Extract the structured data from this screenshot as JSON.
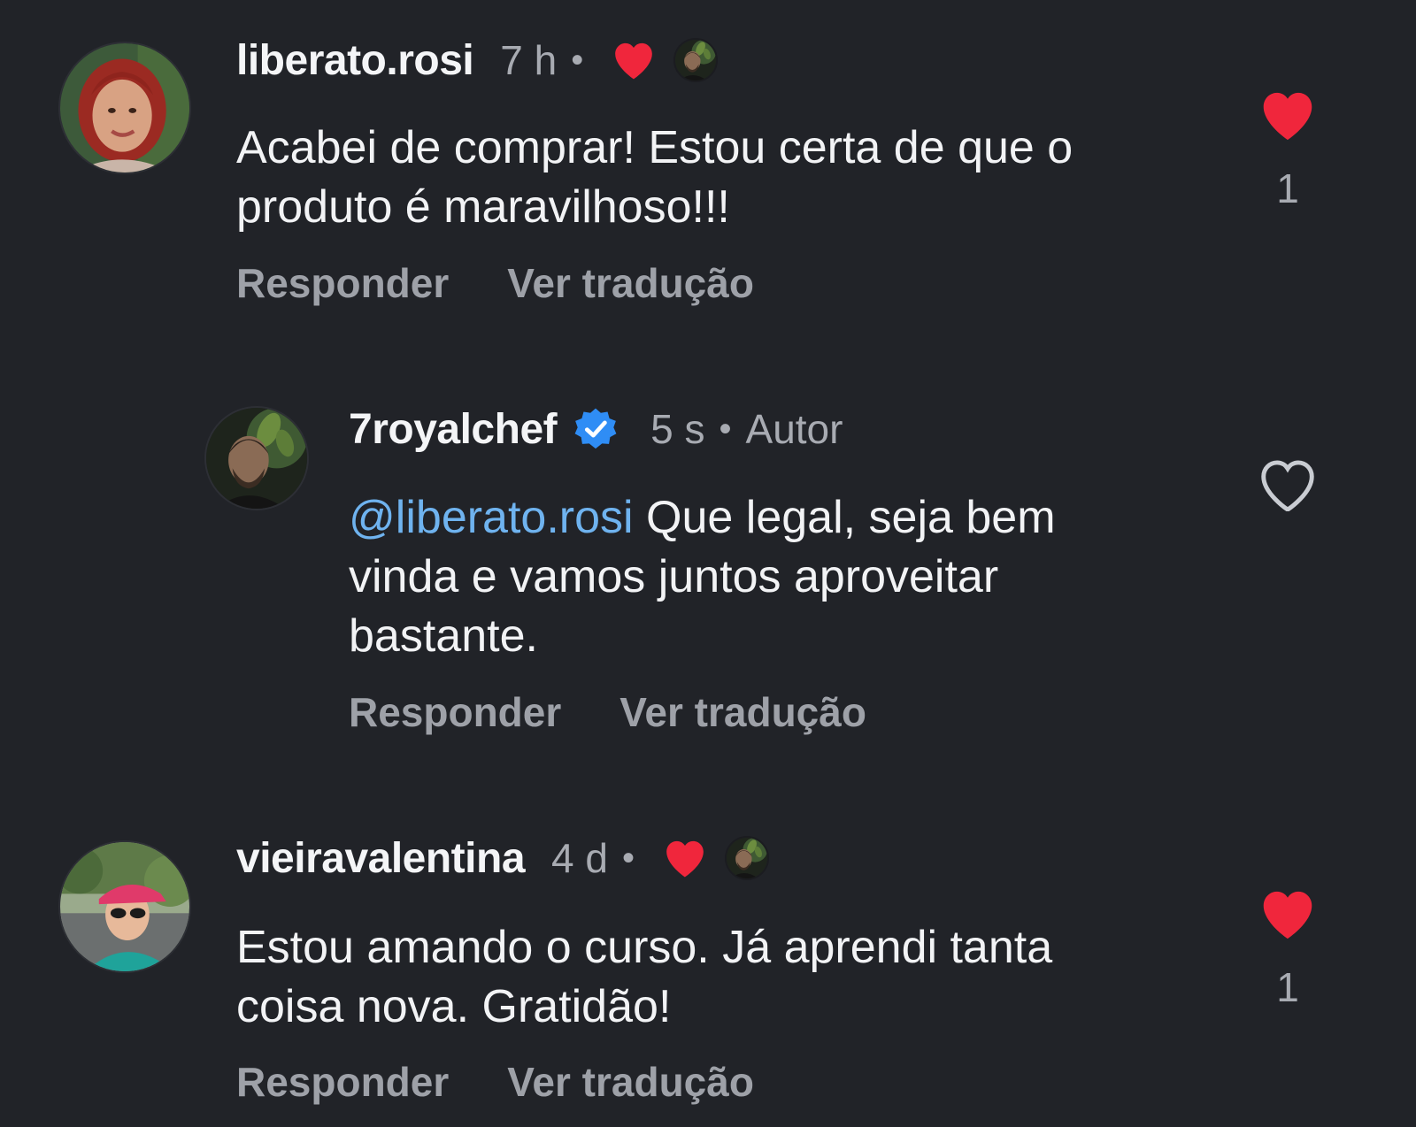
{
  "colors": {
    "background": "#212328",
    "heart_red": "#f0263c",
    "mention_blue": "#6fb3ef",
    "verified_blue": "#2f8df5",
    "muted_text": "#a8abb2"
  },
  "comments": [
    {
      "username": "liberato.rosi",
      "time": "7 h",
      "separator": "•",
      "liked_by_creator_icon": "red-heart-icon",
      "text": "Acabei de comprar! Estou certa de que o produto é  maravilhoso!!!",
      "actions": {
        "reply": "Responder",
        "translate": "Ver tradução"
      },
      "like_icon": "filled-heart-icon",
      "like_count": "1"
    },
    {
      "username": "7royalchef",
      "verified_icon": "verified-badge-icon",
      "time": "5 s",
      "separator": "•",
      "author_tag": "Autor",
      "mention": "@liberato.rosi",
      "text": " Que legal, seja bem vinda e vamos juntos aproveitar bastante.",
      "actions": {
        "reply": "Responder",
        "translate": "Ver tradução"
      },
      "like_icon": "outline-heart-icon"
    },
    {
      "username": "vieiravalentina",
      "time": "4 d",
      "separator": "•",
      "liked_by_creator_icon": "red-heart-icon",
      "text": "Estou amando o curso. Já aprendi tanta coisa nova. Gratidão!",
      "actions": {
        "reply": "Responder",
        "translate": "Ver tradução"
      },
      "like_icon": "filled-heart-icon",
      "like_count": "1"
    }
  ]
}
